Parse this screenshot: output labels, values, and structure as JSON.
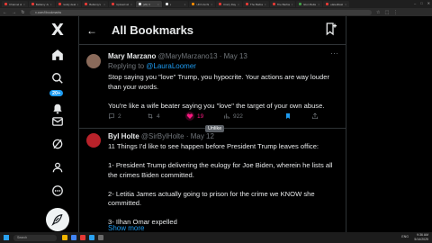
{
  "browser": {
    "tabs": [
      {
        "label": "Channel details",
        "color": "#e53935"
      },
      {
        "label": "Bellamy Justin Kelley",
        "color": "#e53935"
      },
      {
        "label": "candy dealer",
        "color": "#e53935"
      },
      {
        "label": "Bellamy's Dairy",
        "color": "#e53935"
      },
      {
        "label": "Upload videos",
        "color": "#e53935"
      },
      {
        "label": "(20) X",
        "color": "#e7e9ea"
      },
      {
        "label": "x",
        "color": "#e7e9ea"
      },
      {
        "label": "UFO Archive",
        "color": "#fb8c00"
      },
      {
        "label": "Crazy Days and Nights",
        "color": "#e53935"
      },
      {
        "label": "The Barbara Fr...",
        "color": "#e53935"
      },
      {
        "label": "The Barbara Fr...",
        "color": "#e53935"
      },
      {
        "label": "Elon Bellamy Mr...",
        "color": "#43a047"
      },
      {
        "label": "elatedbaskets",
        "color": "#e53935"
      }
    ],
    "url": "x.com/i/bookmarks"
  },
  "sidebar": {
    "logo": "X",
    "notification_count": "20+",
    "items": [
      {
        "name": "home-icon"
      },
      {
        "name": "explore-icon"
      },
      {
        "name": "notifications-icon"
      },
      {
        "name": "messages-icon"
      },
      {
        "name": "grok-icon"
      },
      {
        "name": "profile-icon"
      },
      {
        "name": "more-icon"
      }
    ]
  },
  "header": {
    "back": "←",
    "title": "All Bookmarks"
  },
  "tweets": [
    {
      "name": "Mary Marzano",
      "handle": "@MaryMarzano13 · May 13",
      "replying_prefix": "Replying to ",
      "replying_mention": "@LauraLoomer",
      "paragraphs": [
        "Stop saying you \"love\" Trump, you hypocrite. Your actions are way louder than your words.",
        "You're like a wife beater saying you \"love\" the target of your own abuse."
      ],
      "actions": {
        "replies": "2",
        "reposts": "4",
        "likes": "19",
        "views": "922"
      }
    },
    {
      "name": "Byl Holte",
      "handle": "@SirBylHolte · May 12",
      "paragraphs": [
        "11 Things I'd like to see happen before President Trump leaves office:",
        "1- President Trump delivering the eulogy for Joe Biden, wherein he lists all the crimes Biden committed.",
        "2- Letitia James actually going to prison for the crime we KNOW she committed.",
        "3- Ilhan Omar expelled"
      ],
      "show_more": "Show more"
    }
  ],
  "tooltip": "Unlike",
  "taskbar": {
    "search_placeholder": "Search",
    "time": "9:36 AM",
    "date": "5/14/2025",
    "tray": "ENG"
  }
}
